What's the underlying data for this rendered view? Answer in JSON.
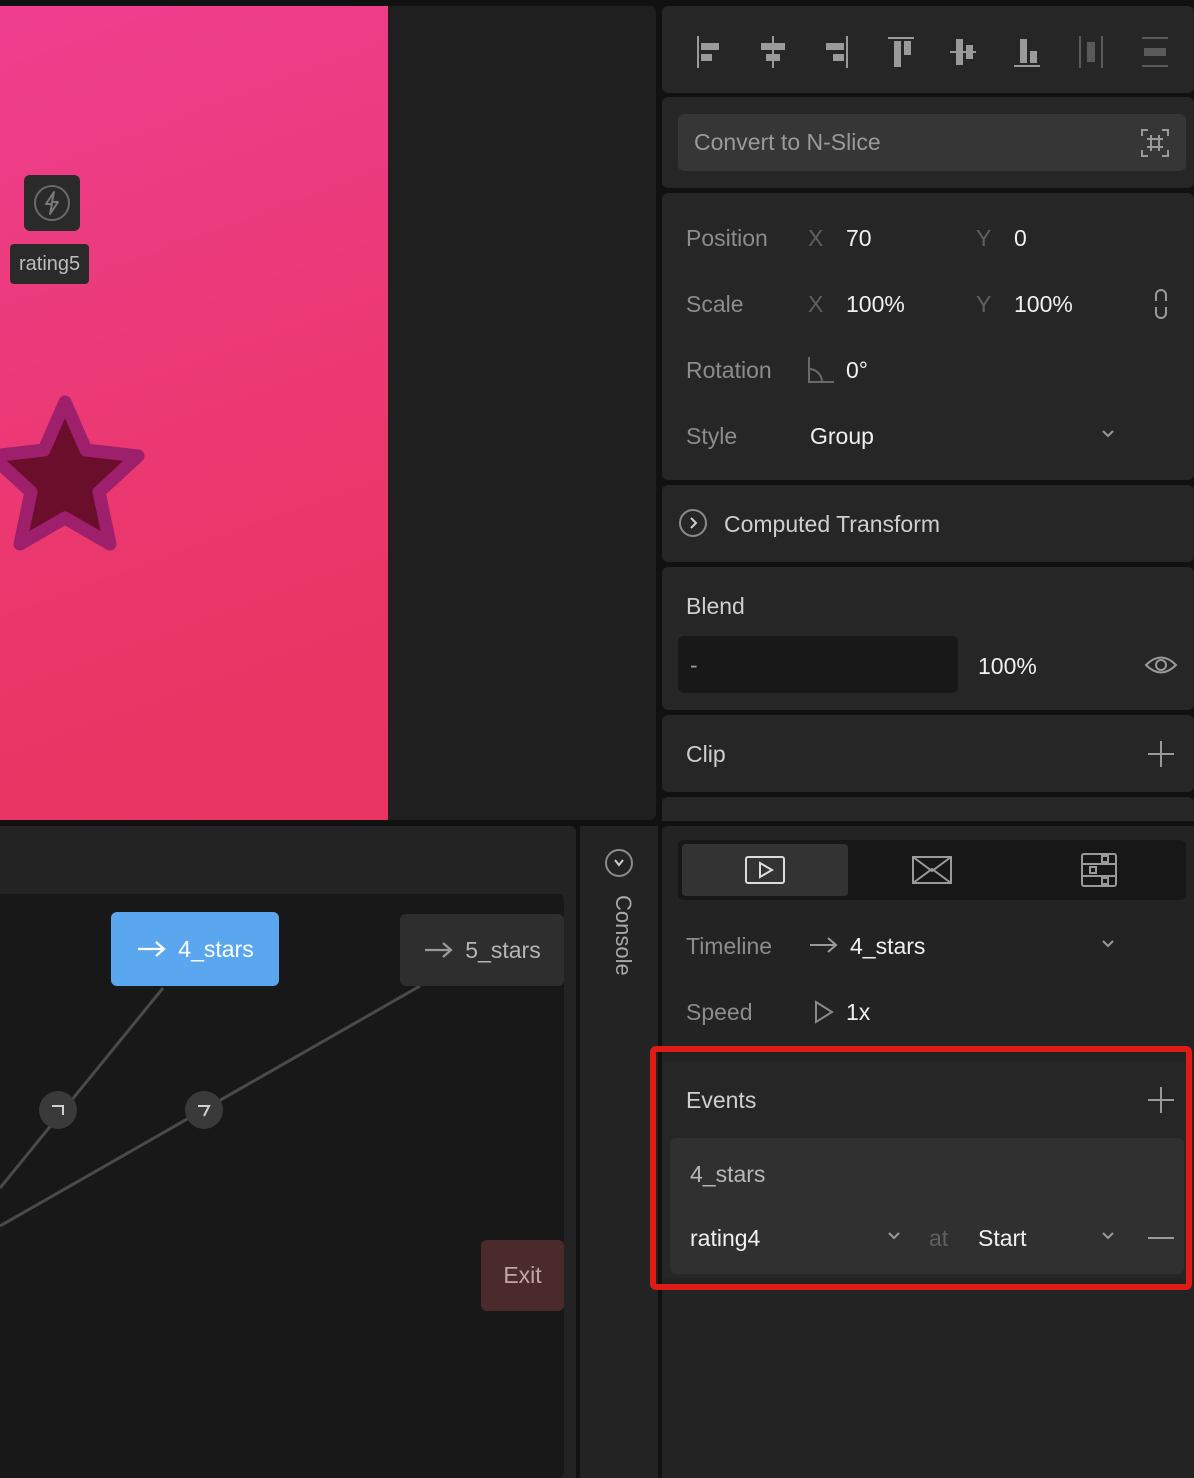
{
  "canvas": {
    "artboard_color_start": "#ee3f8f",
    "artboard_color_end": "#e8345f",
    "event_node": {
      "icon": "lightning-icon",
      "label": "rating5"
    },
    "star": {
      "icon": "star-icon",
      "fill": "#6b0e2c",
      "stroke": "#9e1f6b"
    }
  },
  "state_machine": {
    "states": [
      {
        "name": "4_stars",
        "active": true,
        "icon": "arrow-right-icon"
      },
      {
        "name": "5_stars",
        "active": false,
        "icon": "arrow-right-icon"
      },
      {
        "name": "Exit",
        "active": false
      }
    ],
    "conditions": [
      "condition-icon",
      "condition-icon"
    ]
  },
  "console": {
    "label": "Console",
    "toggle_icon": "chevron-down-icon"
  },
  "inspector": {
    "align_tools": [
      "align-left-icon",
      "align-horizontal-center-icon",
      "align-right-icon",
      "align-top-icon",
      "align-vertical-center-icon",
      "align-bottom-icon",
      "distribute-horizontal-icon",
      "distribute-vertical-icon"
    ],
    "nslice": {
      "label": "Convert to N-Slice",
      "icon": "nslice-icon"
    },
    "transform": {
      "position_label": "Position",
      "position_x_axis": "X",
      "position_x": "70",
      "position_y_axis": "Y",
      "position_y": "0",
      "scale_label": "Scale",
      "scale_x_axis": "X",
      "scale_x": "100%",
      "scale_y_axis": "Y",
      "scale_y": "100%",
      "rotation_label": "Rotation",
      "rotation_value": "0°",
      "style_label": "Style",
      "style_value": "Group"
    },
    "computed_transform": {
      "label": "Computed Transform"
    },
    "blend": {
      "title": "Blend",
      "mode": "-",
      "opacity": "100%"
    },
    "clip": {
      "title": "Clip"
    },
    "animation": {
      "tabs": [
        {
          "icon": "play-icon",
          "active": true
        },
        {
          "icon": "envelope-icon",
          "active": false
        },
        {
          "icon": "sliders-icon",
          "active": false
        }
      ],
      "timeline_label": "Timeline",
      "timeline_value": "4_stars",
      "speed_label": "Speed",
      "speed_value": "1x",
      "events": {
        "title": "Events",
        "items": [
          {
            "timeline": "4_stars",
            "event": "rating4",
            "at_label": "at",
            "position": "Start"
          }
        ]
      }
    }
  }
}
